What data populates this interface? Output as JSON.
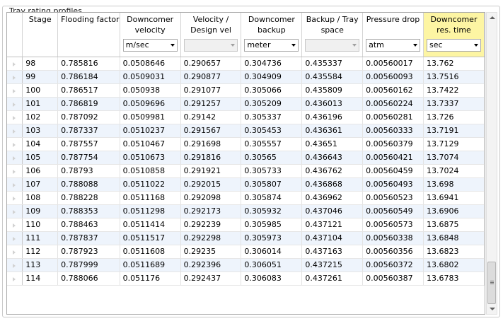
{
  "panel": {
    "title": "Tray rating profiles"
  },
  "columns": [
    {
      "label": "Stage"
    },
    {
      "label": "Flooding factor"
    },
    {
      "label": "Downcomer velocity",
      "unit": "m/sec"
    },
    {
      "label": "Velocity / Design vel",
      "unit": ""
    },
    {
      "label": "Downcomer backup",
      "unit": "meter"
    },
    {
      "label": "Backup / Tray space",
      "unit": ""
    },
    {
      "label": "Pressure drop",
      "unit": "atm"
    },
    {
      "label": "Downcomer res. time",
      "unit": "sec"
    }
  ],
  "rows": [
    [
      "98",
      "0.785816",
      "0.0508646",
      "0.290657",
      "0.304736",
      "0.435337",
      "0.00560017",
      "13.762"
    ],
    [
      "99",
      "0.786184",
      "0.0509031",
      "0.290877",
      "0.304909",
      "0.435584",
      "0.00560093",
      "13.7516"
    ],
    [
      "100",
      "0.786517",
      "0.050938",
      "0.291077",
      "0.305066",
      "0.435809",
      "0.00560162",
      "13.7422"
    ],
    [
      "101",
      "0.786819",
      "0.0509696",
      "0.291257",
      "0.305209",
      "0.436013",
      "0.00560224",
      "13.7337"
    ],
    [
      "102",
      "0.787092",
      "0.0509981",
      "0.29142",
      "0.305337",
      "0.436196",
      "0.00560281",
      "13.726"
    ],
    [
      "103",
      "0.787337",
      "0.0510237",
      "0.291567",
      "0.305453",
      "0.436361",
      "0.00560333",
      "13.7191"
    ],
    [
      "104",
      "0.787557",
      "0.0510467",
      "0.291698",
      "0.305557",
      "0.43651",
      "0.00560379",
      "13.7129"
    ],
    [
      "105",
      "0.787754",
      "0.0510673",
      "0.291816",
      "0.30565",
      "0.436643",
      "0.00560421",
      "13.7074"
    ],
    [
      "106",
      "0.78793",
      "0.0510858",
      "0.291921",
      "0.305733",
      "0.436762",
      "0.00560459",
      "13.7024"
    ],
    [
      "107",
      "0.788088",
      "0.0511022",
      "0.292015",
      "0.305807",
      "0.436868",
      "0.00560493",
      "13.698"
    ],
    [
      "108",
      "0.788228",
      "0.0511168",
      "0.292098",
      "0.305874",
      "0.436962",
      "0.00560523",
      "13.6941"
    ],
    [
      "109",
      "0.788353",
      "0.0511298",
      "0.292173",
      "0.305932",
      "0.437046",
      "0.00560549",
      "13.6906"
    ],
    [
      "110",
      "0.788463",
      "0.0511414",
      "0.292239",
      "0.305985",
      "0.437121",
      "0.00560573",
      "13.6875"
    ],
    [
      "111",
      "0.787837",
      "0.0511517",
      "0.292298",
      "0.305973",
      "0.437104",
      "0.00560338",
      "13.6848"
    ],
    [
      "112",
      "0.787923",
      "0.0511608",
      "0.29235",
      "0.306014",
      "0.437163",
      "0.00560356",
      "13.6823"
    ],
    [
      "113",
      "0.787999",
      "0.0511689",
      "0.292396",
      "0.306051",
      "0.437215",
      "0.00560372",
      "13.6802"
    ],
    [
      "114",
      "0.788066",
      "0.051176",
      "0.292437",
      "0.306083",
      "0.437261",
      "0.00560387",
      "13.6783"
    ]
  ],
  "colors": {
    "selected_header": "#fdf5a3",
    "alt_row": "#eef4fc"
  }
}
